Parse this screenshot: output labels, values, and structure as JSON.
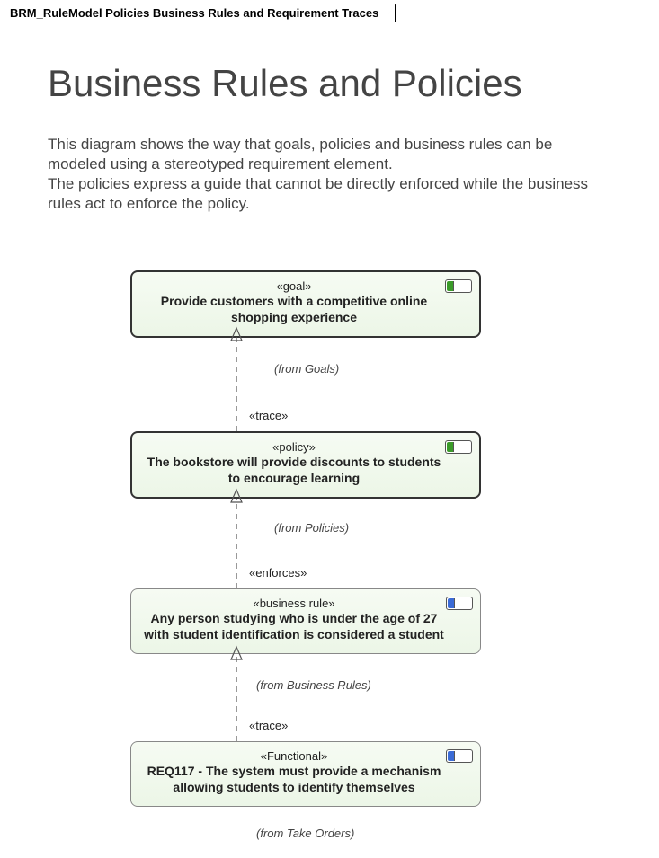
{
  "frame_title": "BRM_RuleModel Policies Business Rules and Requirement Traces",
  "page_title": "Business Rules and Policies",
  "description": "This diagram shows the way that goals, policies and business rules can be modeled using a stereotyped requirement element.\nThe policies express a guide that cannot be directly enforced while the business rules act to enforce the policy.",
  "nodes": {
    "goal": {
      "stereotype": "«goal»",
      "text": "Provide customers with a competitive online shopping experience",
      "package": "(from Goals)",
      "badge_color": "green"
    },
    "policy": {
      "stereotype": "«policy»",
      "text": "The bookstore will provide discounts to students to encourage learning",
      "package": "(from Policies)",
      "badge_color": "green"
    },
    "rule": {
      "stereotype": "«business rule»",
      "text": "Any person studying who is under the age of 27 with student identification is considered a student",
      "package": "(from Business Rules)",
      "badge_color": "blue"
    },
    "functional": {
      "stereotype": "«Functional»",
      "text": "REQ117 - The system must provide a mechanism allowing students to identify themselves",
      "package": "(from Take Orders)",
      "badge_color": "blue"
    }
  },
  "connectors": {
    "goal_policy": {
      "label": "«trace»"
    },
    "policy_rule": {
      "label": "«enforces»"
    },
    "rule_functional": {
      "label": "«trace»"
    }
  }
}
